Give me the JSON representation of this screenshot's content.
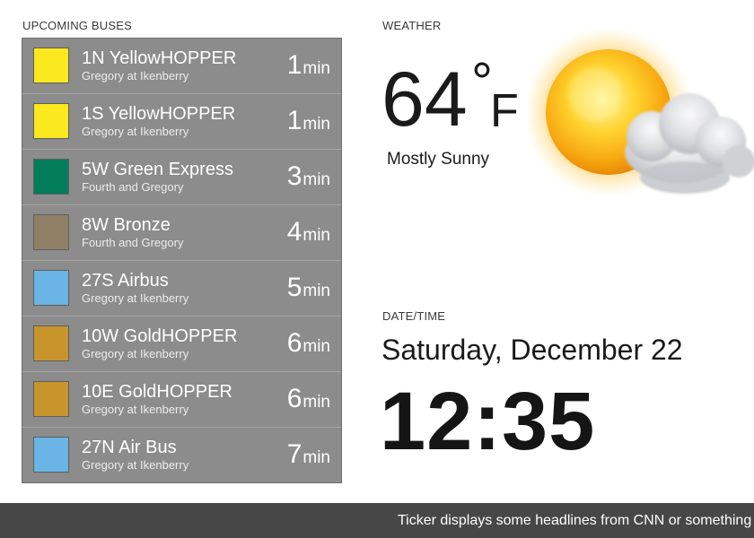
{
  "buses": {
    "label": "UPCOMING BUSES",
    "unit": "min",
    "items": [
      {
        "route": "1N YellowHOPPER",
        "stop": "Gregory at Ikenberry",
        "eta": "1",
        "color": "#fbe81e"
      },
      {
        "route": "1S YellowHOPPER",
        "stop": "Gregory at Ikenberry",
        "eta": "1",
        "color": "#fbe81e"
      },
      {
        "route": "5W Green Express",
        "stop": "Fourth and Gregory",
        "eta": "3",
        "color": "#027d5a"
      },
      {
        "route": "8W Bronze",
        "stop": "Fourth and Gregory",
        "eta": "4",
        "color": "#8f8065"
      },
      {
        "route": "27S Airbus",
        "stop": "Gregory at Ikenberry",
        "eta": "5",
        "color": "#6ab5e5"
      },
      {
        "route": "10W GoldHOPPER",
        "stop": "Gregory at Ikenberry",
        "eta": "6",
        "color": "#c8952c"
      },
      {
        "route": "10E GoldHOPPER",
        "stop": "Gregory at Ikenberry",
        "eta": "6",
        "color": "#c8952c"
      },
      {
        "route": "27N Air Bus",
        "stop": "Gregory at Ikenberry",
        "eta": "7",
        "color": "#6ab5e5"
      }
    ]
  },
  "weather": {
    "label": "WEATHER",
    "temperature": "64",
    "degree_symbol": "°",
    "unit": "F",
    "condition": "Mostly Sunny",
    "icon": "partly-cloudy-sun-icon"
  },
  "datetime": {
    "label": "DATE/TIME",
    "date": "Saturday, December 22",
    "time": "12:35"
  },
  "ticker": {
    "text": "Ticker displays some headlines from CNN or something"
  }
}
